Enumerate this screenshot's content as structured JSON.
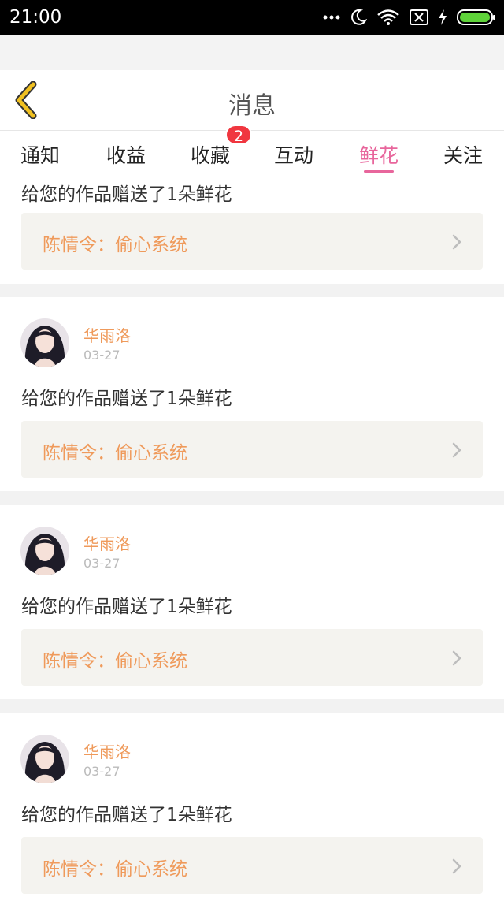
{
  "status": {
    "time": "21:00",
    "icons": [
      "more-dots-icon",
      "moon-icon",
      "wifi-icon",
      "no-sim-icon",
      "charging-icon",
      "battery-icon"
    ]
  },
  "header": {
    "title": "消息",
    "back_icon": "chevron-left-icon",
    "accent": "#f0c020"
  },
  "tabs": [
    {
      "label": "通知"
    },
    {
      "label": "收益"
    },
    {
      "label": "收藏",
      "badge": "2"
    },
    {
      "label": "互动"
    },
    {
      "label": "鲜花",
      "active": true
    },
    {
      "label": "关注"
    }
  ],
  "colors": {
    "active_tab": "#e8669c",
    "badge": "#f0363f",
    "author": "#ef9a5b",
    "link_bg": "#f4f3ef"
  },
  "messages": [
    {
      "message": "给您的作品赠送了1朵鲜花",
      "work": "陈情令：偷心系统"
    },
    {
      "author": "华雨洛",
      "date": "03-27",
      "message": "给您的作品赠送了1朵鲜花",
      "work": "陈情令：偷心系统"
    },
    {
      "author": "华雨洛",
      "date": "03-27",
      "message": "给您的作品赠送了1朵鲜花",
      "work": "陈情令：偷心系统"
    },
    {
      "author": "华雨洛",
      "date": "03-27",
      "message": "给您的作品赠送了1朵鲜花",
      "work": "陈情令：偷心系统"
    }
  ]
}
